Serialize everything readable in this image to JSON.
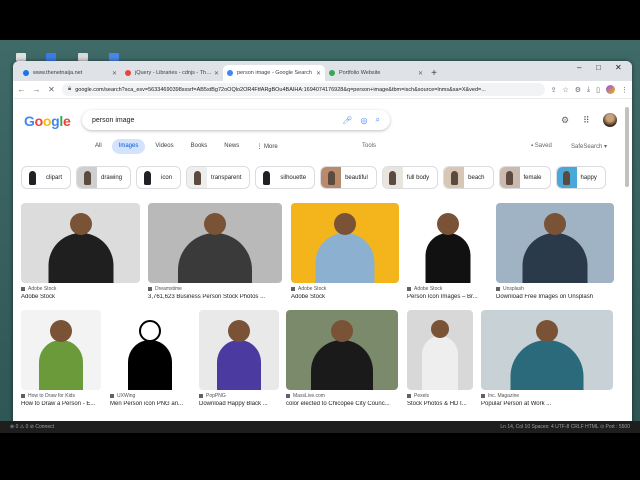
{
  "browser": {
    "tabs": [
      {
        "label": "www.thenetnaija.net",
        "fav": "#1a73e8"
      },
      {
        "label": "jQuery - Libraries - cdnjs - The #1",
        "fav": "#e8453c"
      },
      {
        "label": "person image - Google Search",
        "fav": "#4285f4",
        "active": true
      },
      {
        "label": "Portfolio Website",
        "fav": "#34a853"
      }
    ],
    "new_tab": "+",
    "window_controls": {
      "minimize": "–",
      "maximize": "□",
      "close": "✕"
    },
    "url": "google.com/search?sca_esv=56334690398sxsrf=AB5stBg72oOQlo2OR4FtfARgBOu4BAIHA:1694074176928&q=person+image&tbm=isch&source=lnms&sa=X&ved=..."
  },
  "google": {
    "logo_letters": [
      {
        "ch": "G",
        "color": "#4285f4"
      },
      {
        "ch": "o",
        "color": "#ea4335"
      },
      {
        "ch": "o",
        "color": "#fbbc05"
      },
      {
        "ch": "g",
        "color": "#4285f4"
      },
      {
        "ch": "l",
        "color": "#34a853"
      },
      {
        "ch": "e",
        "color": "#ea4335"
      }
    ],
    "search_query": "person image",
    "nav_filters": [
      {
        "label": "All",
        "selected": false
      },
      {
        "label": "Images",
        "selected": true
      },
      {
        "label": "Videos",
        "selected": false
      },
      {
        "label": "Books",
        "selected": false
      },
      {
        "label": "News",
        "selected": false
      },
      {
        "label": "⋮ More",
        "selected": false
      }
    ],
    "tools_label": "Tools",
    "saved_label": "Saved",
    "safesearch_label": "SafeSearch",
    "chips": [
      {
        "label": "clipart",
        "thumb": "#ffffff"
      },
      {
        "label": "drawing",
        "thumb": "#cfcfcf"
      },
      {
        "label": "icon",
        "thumb": "#ffffff"
      },
      {
        "label": "transparent",
        "thumb": "#eeeeee"
      },
      {
        "label": "silhouette",
        "thumb": "#ffffff"
      },
      {
        "label": "beautiful",
        "thumb": "#b98a6b"
      },
      {
        "label": "full body",
        "thumb": "#e9e4de"
      },
      {
        "label": "beach",
        "thumb": "#d8c7b5"
      },
      {
        "label": "female",
        "thumb": "#c9b9ae"
      },
      {
        "label": "happy",
        "thumb": "#4aa8d8"
      }
    ],
    "row1": [
      {
        "source": "Adobe Stock",
        "title": "Adobe Stock",
        "bg": "#dcdcdc"
      },
      {
        "source": "Dreamstime",
        "title": "3,761,623 Business Person Stock Photos ...",
        "bg": "#b9b9b9"
      },
      {
        "source": "Adobe Stock",
        "title": "Adobe Stock",
        "bg": "#f3b51b"
      },
      {
        "source": "Adobe Stock",
        "title": "Person Icon Images – Br...",
        "bg": "#ffffff"
      },
      {
        "source": "Unsplash",
        "title": "Download Free Images on Unsplash",
        "bg": "#9fb3c4"
      }
    ],
    "row2": [
      {
        "source": "How to Draw for Kids",
        "title": "How to Draw a Person - E...",
        "bg": "#f3f3f3"
      },
      {
        "source": "UXWing",
        "title": "Men Person icon PNG an...",
        "bg": "#ffffff"
      },
      {
        "source": "PopPNG",
        "title": "Download Happy Black ...",
        "bg": "#e9e9e9"
      },
      {
        "source": "MassLive.com",
        "title": "color elected to Chicopee City Counc...",
        "bg": "#7a8a6a"
      },
      {
        "source": "Pexels",
        "title": "Stock Photos & HD I...",
        "bg": "#d8d8d8"
      },
      {
        "source": "Inc. Magazine",
        "title": "Popular Person at Work ...",
        "bg": "#c8d2d6"
      }
    ]
  },
  "statusbar": {
    "left": "⊗ 0 ⚠ 0   ⊘ Connect",
    "right": "Ln 14, Col 10   Spaces: 4   UTF-8   CRLF   HTML   ⊙ Port : 5500"
  }
}
